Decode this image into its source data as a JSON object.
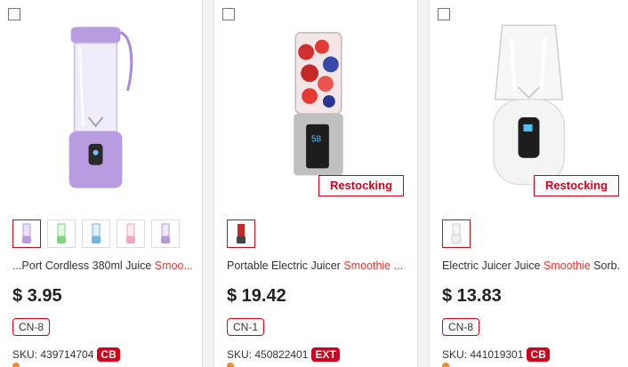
{
  "products": [
    {
      "title_plain": "...Port Cordless 380ml Juice ",
      "title_hl": "Smoo...",
      "price": "$ 3.95",
      "warehouse": "CN-8",
      "sku": "SKU: 439714704",
      "badge": "CB",
      "thumb_colors": [
        "#b89be0",
        "#7fd67c",
        "#6fb5e6",
        "#f2a6c4",
        "#b99ad8"
      ]
    },
    {
      "title_plain": "Portable Electric Juicer ",
      "title_hl": "Smoothie ...",
      "price": "$ 19.42",
      "warehouse": "CN-1",
      "sku": "SKU: 450822401",
      "badge": "EXT",
      "restock": "Restocking",
      "thumb_colors": [
        "#c62828"
      ]
    },
    {
      "title_plain": "Electric Juicer Juice ",
      "title_hl": "Smoothie",
      "title_tail": " Sorb...",
      "price": "$ 13.83",
      "warehouse": "CN-8",
      "sku": "SKU: 441019301",
      "badge": "CB",
      "restock": "Restocking",
      "thumb_colors": [
        "#e8e8e8"
      ]
    }
  ],
  "colors": {
    "accent_red": "#d0021b",
    "highlight_red": "#e53935",
    "blender1_body": "#b89be0",
    "blender2_body": "#c0c0c0",
    "blender3_body": "#f4f4f4"
  }
}
